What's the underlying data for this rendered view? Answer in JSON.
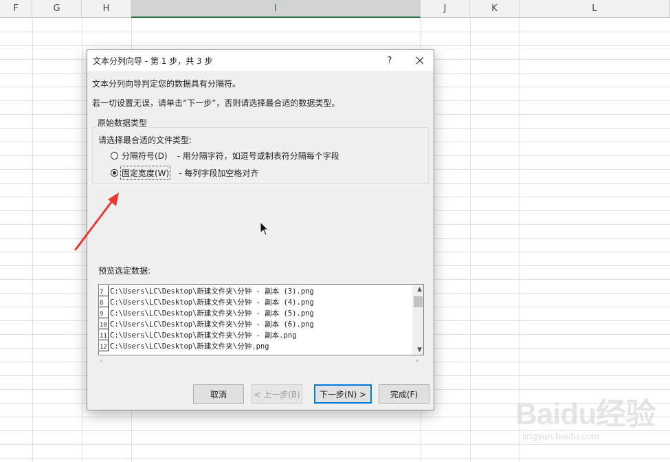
{
  "sheet": {
    "columns": [
      "F",
      "G",
      "H",
      "I",
      "J",
      "K",
      "L"
    ],
    "selected_column": "I"
  },
  "dialog": {
    "title": "文本分列向导 - 第 1 步，共 3 步",
    "help_label": "?",
    "line1": "文本分列向导判定您的数据具有分隔符。",
    "line2": "若一切设置无误，请单击“下一步”，否则请选择最合适的数据类型。",
    "group_title": "原始数据类型",
    "group_prompt": "请选择最合适的文件类型:",
    "options": [
      {
        "label": "分隔符号(D)",
        "desc": "- 用分隔字符，如逗号或制表符分隔每个字段",
        "checked": false
      },
      {
        "label": "固定宽度(W)",
        "desc": "- 每列字段加空格对齐",
        "checked": true
      }
    ],
    "preview_label": "预览选定数据:",
    "preview_rows": [
      {
        "num": "7",
        "text": "C:\\Users\\LC\\Desktop\\新建文件夹\\分钟 - 副本 (3).png"
      },
      {
        "num": "8",
        "text": "C:\\Users\\LC\\Desktop\\新建文件夹\\分钟 - 副本 (4).png"
      },
      {
        "num": "9",
        "text": "C:\\Users\\LC\\Desktop\\新建文件夹\\分钟 - 副本 (5).png"
      },
      {
        "num": "10",
        "text": "C:\\Users\\LC\\Desktop\\新建文件夹\\分钟 - 副本 (6).png"
      },
      {
        "num": "11",
        "text": "C:\\Users\\LC\\Desktop\\新建文件夹\\分钟 - 副本.png"
      },
      {
        "num": "12",
        "text": "C:\\Users\\LC\\Desktop\\新建文件夹\\分钟.png"
      }
    ],
    "buttons": {
      "cancel": "取消",
      "back": "< 上一步(B)",
      "next": "下一步(N) >",
      "finish": "完成(F)"
    }
  },
  "watermark": {
    "brand": "Baidu经验",
    "sub": "jingyan.baidu.com"
  },
  "colors": {
    "accent": "#217346",
    "annotation_arrow": "#e8382f",
    "default_button_border": "#0078d7"
  },
  "icons": [
    "close-icon",
    "radio-icon",
    "scroll-up-icon",
    "scroll-down-icon",
    "scroll-left-icon",
    "scroll-right-icon",
    "red-annotation-arrow",
    "mouse-cursor-icon"
  ]
}
